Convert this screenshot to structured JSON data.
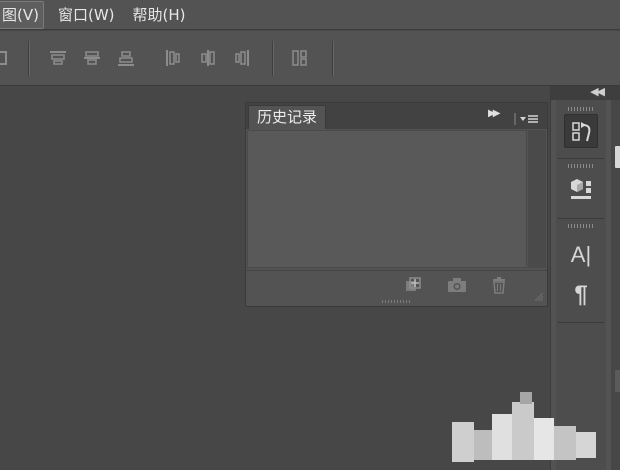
{
  "menu": {
    "items": [
      {
        "label": "图(V)"
      },
      {
        "label": "窗口(W)"
      },
      {
        "label": "帮助(H)"
      }
    ]
  },
  "options_bar": {
    "icons": [
      "align-edges-icon",
      "align-top-edges-icon",
      "align-vertical-centers-icon",
      "align-bottom-edges-icon",
      "align-left-edges-icon",
      "align-horizontal-centers-icon",
      "align-right-edges-icon",
      "distribute-icon"
    ]
  },
  "history_panel": {
    "tab_label": "历史记录",
    "expand_glyph": "▶▶",
    "footer_icons": [
      "new-document-from-state-icon",
      "camera-icon",
      "trash-icon"
    ]
  },
  "dock": {
    "collapse_glyph": "◀◀",
    "buttons": [
      {
        "icon": "history-icon",
        "active": true
      },
      {
        "icon": "3d-cube-icon",
        "active": false
      },
      {
        "icon": "character-icon",
        "glyph": "A|",
        "active": false
      },
      {
        "icon": "paragraph-icon",
        "glyph": "¶",
        "active": false
      }
    ]
  },
  "colors": {
    "app_bg": "#474747",
    "panel_bg": "#535353",
    "panel_header": "#424242",
    "text": "#e4e4e4"
  }
}
